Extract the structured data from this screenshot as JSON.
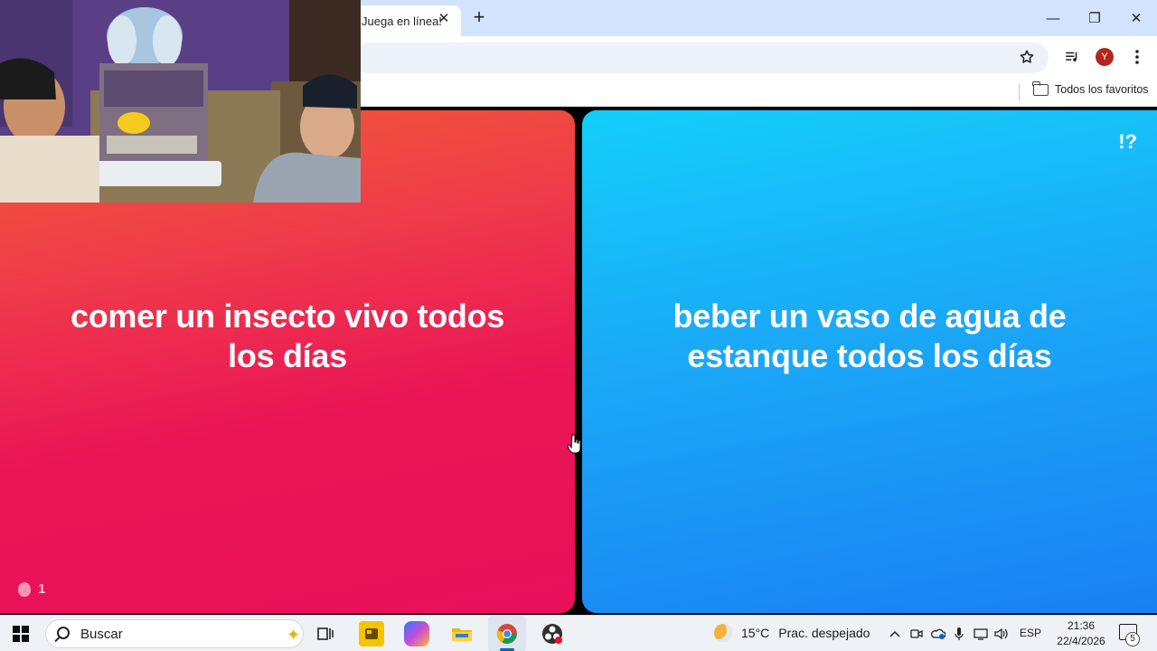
{
  "browser": {
    "tab_title": "Juega en línea!",
    "tab_close": "✕",
    "new_tab": "+",
    "window_controls": {
      "minimize": "—",
      "restore": "❐",
      "close": "✕"
    },
    "profile_initial": "Y",
    "bookmark_all": "Todos los favoritos",
    "icons": [
      "star-icon",
      "media-control-icon",
      "menu-icon",
      "folder-icon"
    ]
  },
  "game": {
    "option_left": "comer un insecto vivo todos los días",
    "option_right": "beber un vaso de agua de estanque todos los días",
    "question_mark": "!?",
    "likes_count": "1",
    "colors": {
      "left": "#ea1556",
      "right": "#1a8ff5"
    }
  },
  "taskbar": {
    "search_label": "Buscar",
    "weather_temp": "15°C",
    "weather_desc": "Prac. despejado",
    "language": "ESP",
    "time": "21:36",
    "date": "22/4/2026",
    "notification_count": "5"
  }
}
